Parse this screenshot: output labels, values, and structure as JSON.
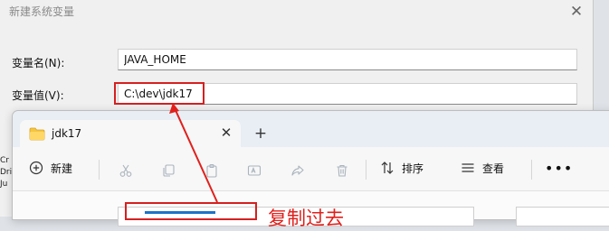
{
  "dialog": {
    "title": "新建系统变量",
    "variable_name_label": "变量名(N):",
    "variable_name_value": "JAVA_HOME",
    "variable_value_label": "变量值(V):",
    "variable_value_value": "C:\\dev\\jdk17"
  },
  "explorer": {
    "tab_label": "jdk17",
    "new_button_label": "新建",
    "sort_button_label": "排序",
    "view_button_label": "查看"
  },
  "annotation": {
    "text": "复制过去",
    "color": "#e0201c"
  },
  "left_edge_fragments": [
    "Cr",
    "Dri",
    "Ju"
  ],
  "colors": {
    "highlight_red": "#d62020",
    "selection_blue": "#1a73c8"
  }
}
